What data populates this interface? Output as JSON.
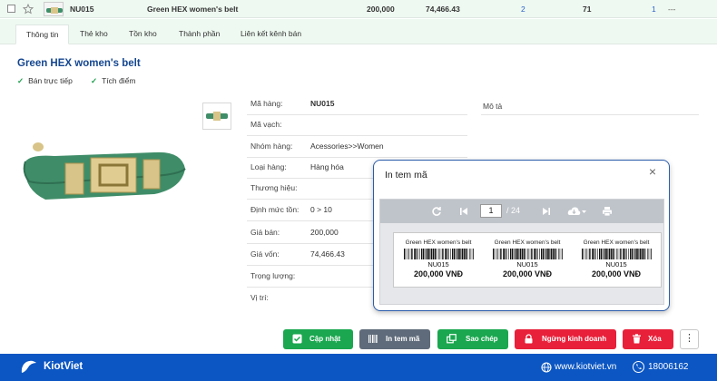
{
  "product_row": {
    "code": "NU015",
    "name": "Green HEX women's belt",
    "price": "200,000",
    "cost": "74,466.43",
    "col_a": "2",
    "col_b": "71",
    "col_c": "1",
    "more": "---"
  },
  "tabs": [
    {
      "label": "Thông tin"
    },
    {
      "label": "Thẻ kho"
    },
    {
      "label": "Tồn kho"
    },
    {
      "label": "Thành phần"
    },
    {
      "label": "Liên kết kênh bán"
    }
  ],
  "detail": {
    "title": "Green HEX women's belt",
    "flags": [
      "Bán trực tiếp",
      "Tích điểm"
    ],
    "fields": [
      {
        "label": "Mã hàng:",
        "value": "NU015"
      },
      {
        "label": "Mã vạch:",
        "value": ""
      },
      {
        "label": "Nhóm hàng:",
        "value": "Acessories>>Women"
      },
      {
        "label": "Loại hàng:",
        "value": "Hàng hóa"
      },
      {
        "label": "Thương hiệu:",
        "value": ""
      },
      {
        "label": "Định mức tồn:",
        "value": "0  >  10"
      },
      {
        "label": "Giá bán:",
        "value": "200,000"
      },
      {
        "label": "Giá vốn:",
        "value": "74,466.43"
      },
      {
        "label": "Trọng lượng:",
        "value": ""
      },
      {
        "label": "Vị trí:",
        "value": ""
      }
    ],
    "description_label": "Mô tả"
  },
  "dialog": {
    "title": "In tem mã",
    "close": "×",
    "page_current": "1",
    "page_total": "/ 24",
    "labels": [
      {
        "name": "Green HEX women's belt",
        "code": "NU015",
        "price": "200,000 VNĐ"
      },
      {
        "name": "Green HEX women's belt",
        "code": "NU015",
        "price": "200,000 VNĐ"
      },
      {
        "name": "Green HEX women's belt",
        "code": "NU015",
        "price": "200,000 VNĐ"
      }
    ]
  },
  "actions": {
    "update": "Cập nhật",
    "print_label": "In tem mã",
    "copy": "Sao chép",
    "stop_selling": "Ngừng kinh doanh",
    "delete": "Xóa",
    "more": "⋮"
  },
  "footer": {
    "brand": "KiotViet",
    "website": "www.kiotviet.vn",
    "hotline": "18006162"
  },
  "colors": {
    "primary_blue": "#0b56c3",
    "green": "#1aa74f",
    "grey_button": "#5f6b7a",
    "red": "#e8203a",
    "product_green": "#3d8f6a"
  }
}
